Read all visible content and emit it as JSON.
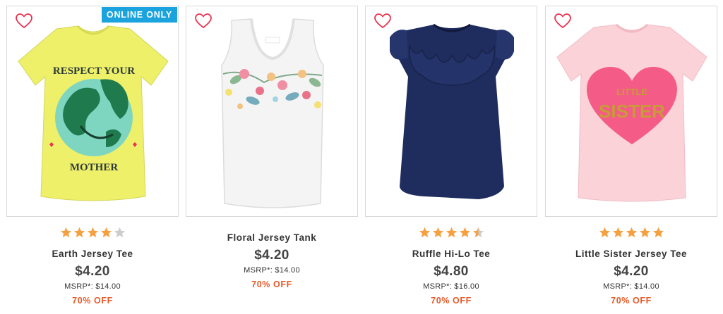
{
  "colors": {
    "accent_sale": "#e65a2a",
    "star_filled": "#f5a141",
    "star_empty": "#cccccc",
    "badge_blue": "#1aa3dc",
    "heart": "#e8334f"
  },
  "products": [
    {
      "name": "Earth Jersey Tee",
      "price": "$4.20",
      "msrp": "MSRP*: $14.00",
      "discount": "70% OFF",
      "badge": "ONLINE ONLY",
      "rating": 4,
      "shirt_text_top": "RESPECT YOUR",
      "shirt_text_bottom": "MOTHER"
    },
    {
      "name": "Floral Jersey Tank",
      "price": "$4.20",
      "msrp": "MSRP*: $14.00",
      "discount": "70% OFF"
    },
    {
      "name": "Ruffle Hi-Lo Tee",
      "price": "$4.80",
      "msrp": "MSRP*: $16.00",
      "discount": "70% OFF",
      "rating": 4.5
    },
    {
      "name": "Little Sister Jersey Tee",
      "price": "$4.20",
      "msrp": "MSRP*: $14.00",
      "discount": "70% OFF",
      "rating": 5,
      "shirt_text_top": "LITTLE",
      "shirt_text_bottom": "SISTER"
    }
  ]
}
